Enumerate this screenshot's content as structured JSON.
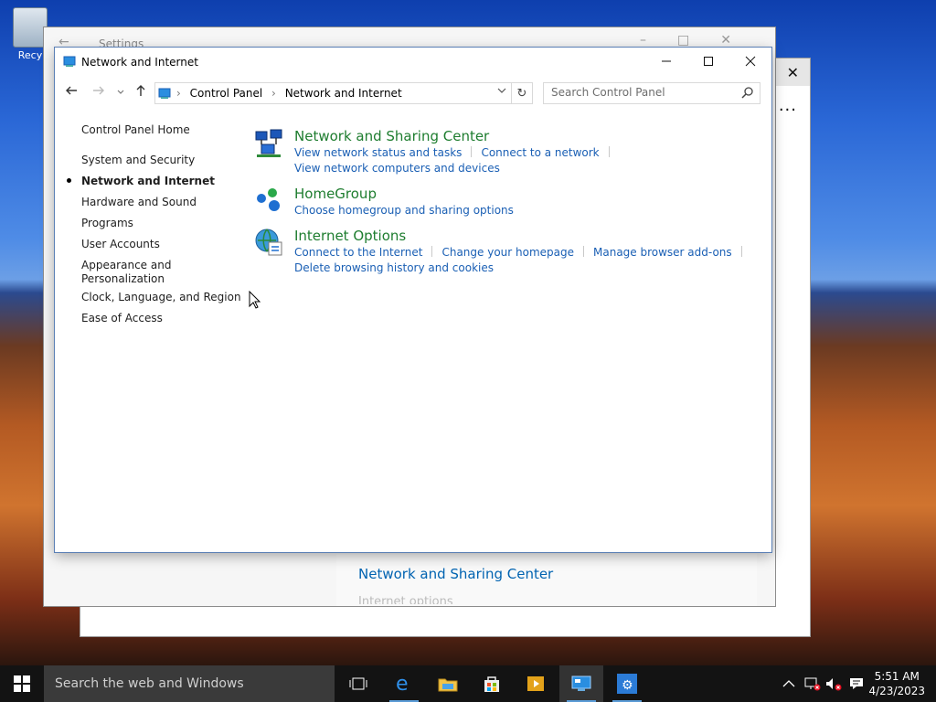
{
  "desktop": {
    "recycle_bin_label": "Recy"
  },
  "back_window_1": {
    "title": "Settings",
    "link": "Network and Sharing Center",
    "cut_text": "Internet options"
  },
  "window": {
    "title": "Network and Internet",
    "nav": {
      "back_icon": "back-arrow-icon",
      "forward_icon": "forward-arrow-icon",
      "recent_icon": "chevron-down-icon",
      "up_icon": "up-arrow-icon"
    },
    "breadcrumbs": [
      "Control Panel",
      "Network and Internet"
    ],
    "search_placeholder": "Search Control Panel",
    "left_nav": [
      {
        "label": "Control Panel Home"
      },
      {
        "label": "System and Security"
      },
      {
        "label": "Network and Internet",
        "selected": true
      },
      {
        "label": "Hardware and Sound"
      },
      {
        "label": "Programs"
      },
      {
        "label": "User Accounts"
      },
      {
        "label": "Appearance and"
      },
      {
        "label": "Personalization"
      },
      {
        "label": "Clock, Language, and Region"
      },
      {
        "label": "Ease of Access"
      }
    ],
    "categories": [
      {
        "title": "Network and Sharing Center",
        "icon": "network-sharing-center-icon",
        "links": [
          "View network status and tasks",
          "Connect to a network",
          "View network computers and devices"
        ]
      },
      {
        "title": "HomeGroup",
        "icon": "homegroup-icon",
        "links": [
          "Choose homegroup and sharing options"
        ]
      },
      {
        "title": "Internet Options",
        "icon": "internet-options-icon",
        "links": [
          "Connect to the Internet",
          "Change your homepage",
          "Manage browser add-ons",
          "Delete browsing history and cookies"
        ]
      }
    ]
  },
  "taskbar": {
    "search_placeholder": "Search the web and Windows",
    "apps": [
      "task-view-icon",
      "edge-icon",
      "file-explorer-icon",
      "store-icon",
      "media-player-icon",
      "control-panel-icon",
      "settings-icon"
    ],
    "clock_time": "5:51 AM",
    "clock_date": "4/23/2023"
  },
  "colors": {
    "link": "#1a5fb4",
    "category_title": "#1e7d2f",
    "taskbar": "#131313"
  }
}
